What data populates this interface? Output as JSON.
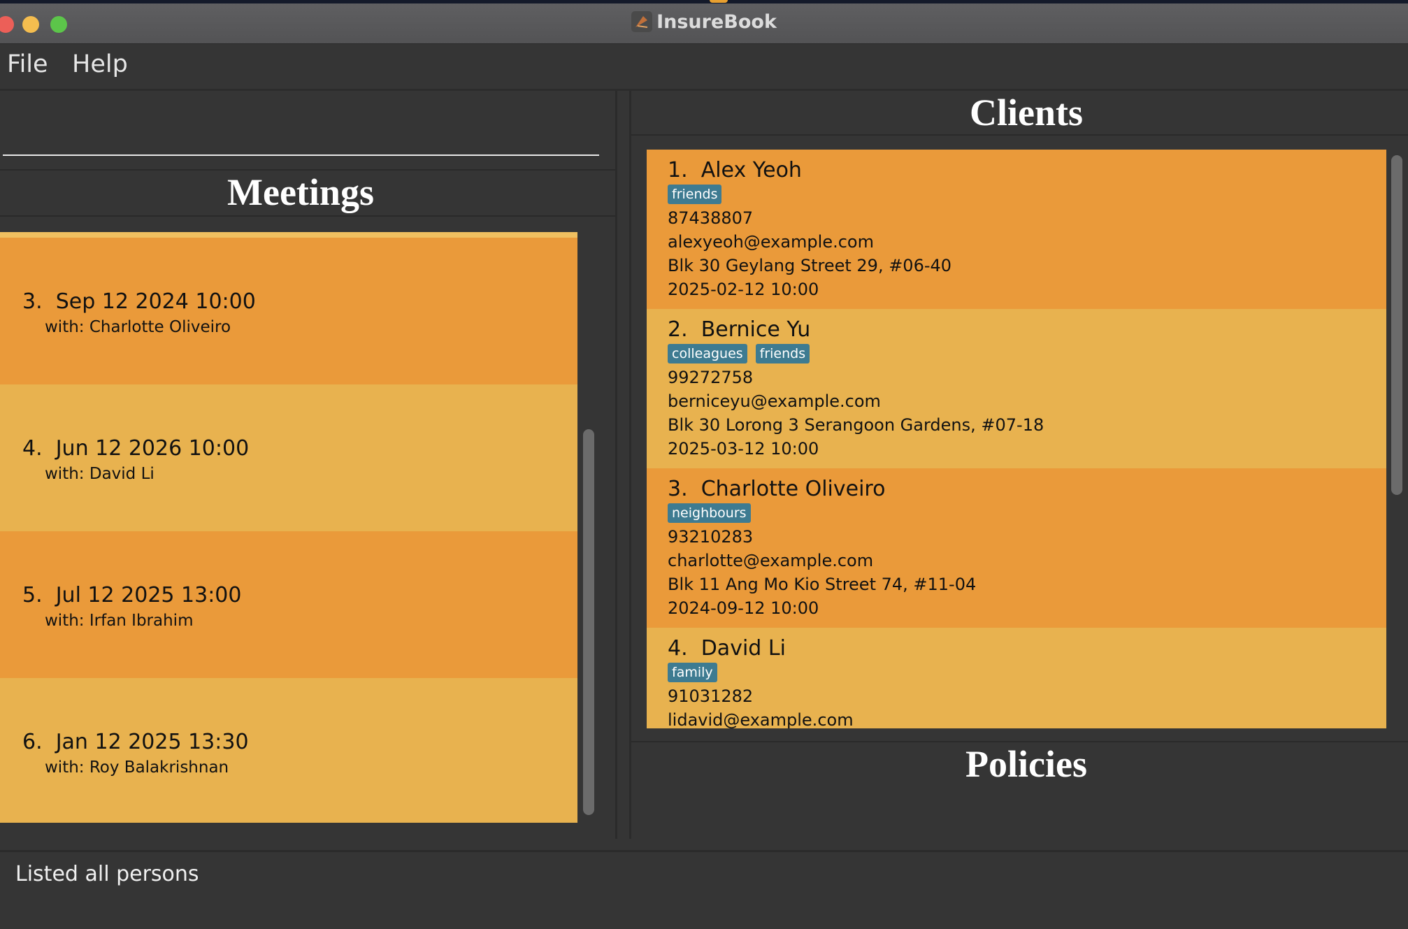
{
  "window": {
    "title": "InsureBook"
  },
  "menu": {
    "file": "File",
    "help": "Help"
  },
  "meetings": {
    "heading": "Meetings",
    "items": [
      {
        "index": "3.",
        "datetime": "Sep 12 2024 10:00",
        "with": "with: Charlotte Oliveiro"
      },
      {
        "index": "4.",
        "datetime": "Jun 12 2026 10:00",
        "with": "with: David Li"
      },
      {
        "index": "5.",
        "datetime": "Jul 12 2025 13:00",
        "with": "with: Irfan Ibrahim"
      },
      {
        "index": "6.",
        "datetime": "Jan 12 2025 13:30",
        "with": "with: Roy Balakrishnan"
      }
    ]
  },
  "clients": {
    "heading": "Clients",
    "items": [
      {
        "index": "1.",
        "name": "Alex Yeoh",
        "tags": [
          "friends"
        ],
        "phone": "87438807",
        "email": "alexyeoh@example.com",
        "address": "Blk 30 Geylang Street 29, #06-40",
        "next_meeting": "2025-02-12 10:00"
      },
      {
        "index": "2.",
        "name": "Bernice Yu",
        "tags": [
          "colleagues",
          "friends"
        ],
        "phone": "99272758",
        "email": "berniceyu@example.com",
        "address": "Blk 30 Lorong 3 Serangoon Gardens, #07-18",
        "next_meeting": "2025-03-12 10:00"
      },
      {
        "index": "3.",
        "name": "Charlotte Oliveiro",
        "tags": [
          "neighbours"
        ],
        "phone": "93210283",
        "email": "charlotte@example.com",
        "address": "Blk 11 Ang Mo Kio Street 74, #11-04",
        "next_meeting": "2024-09-12 10:00"
      },
      {
        "index": "4.",
        "name": "David Li",
        "tags": [
          "family"
        ],
        "phone": "91031282",
        "email": "lidavid@example.com",
        "address": "",
        "next_meeting": ""
      }
    ]
  },
  "policies": {
    "heading": "Policies"
  },
  "status": {
    "message": "Listed all persons"
  },
  "colors": {
    "card_dark": "#ea9a3a",
    "card_light": "#e8b24f",
    "tag": "#3e7b91",
    "background": "#353535"
  }
}
